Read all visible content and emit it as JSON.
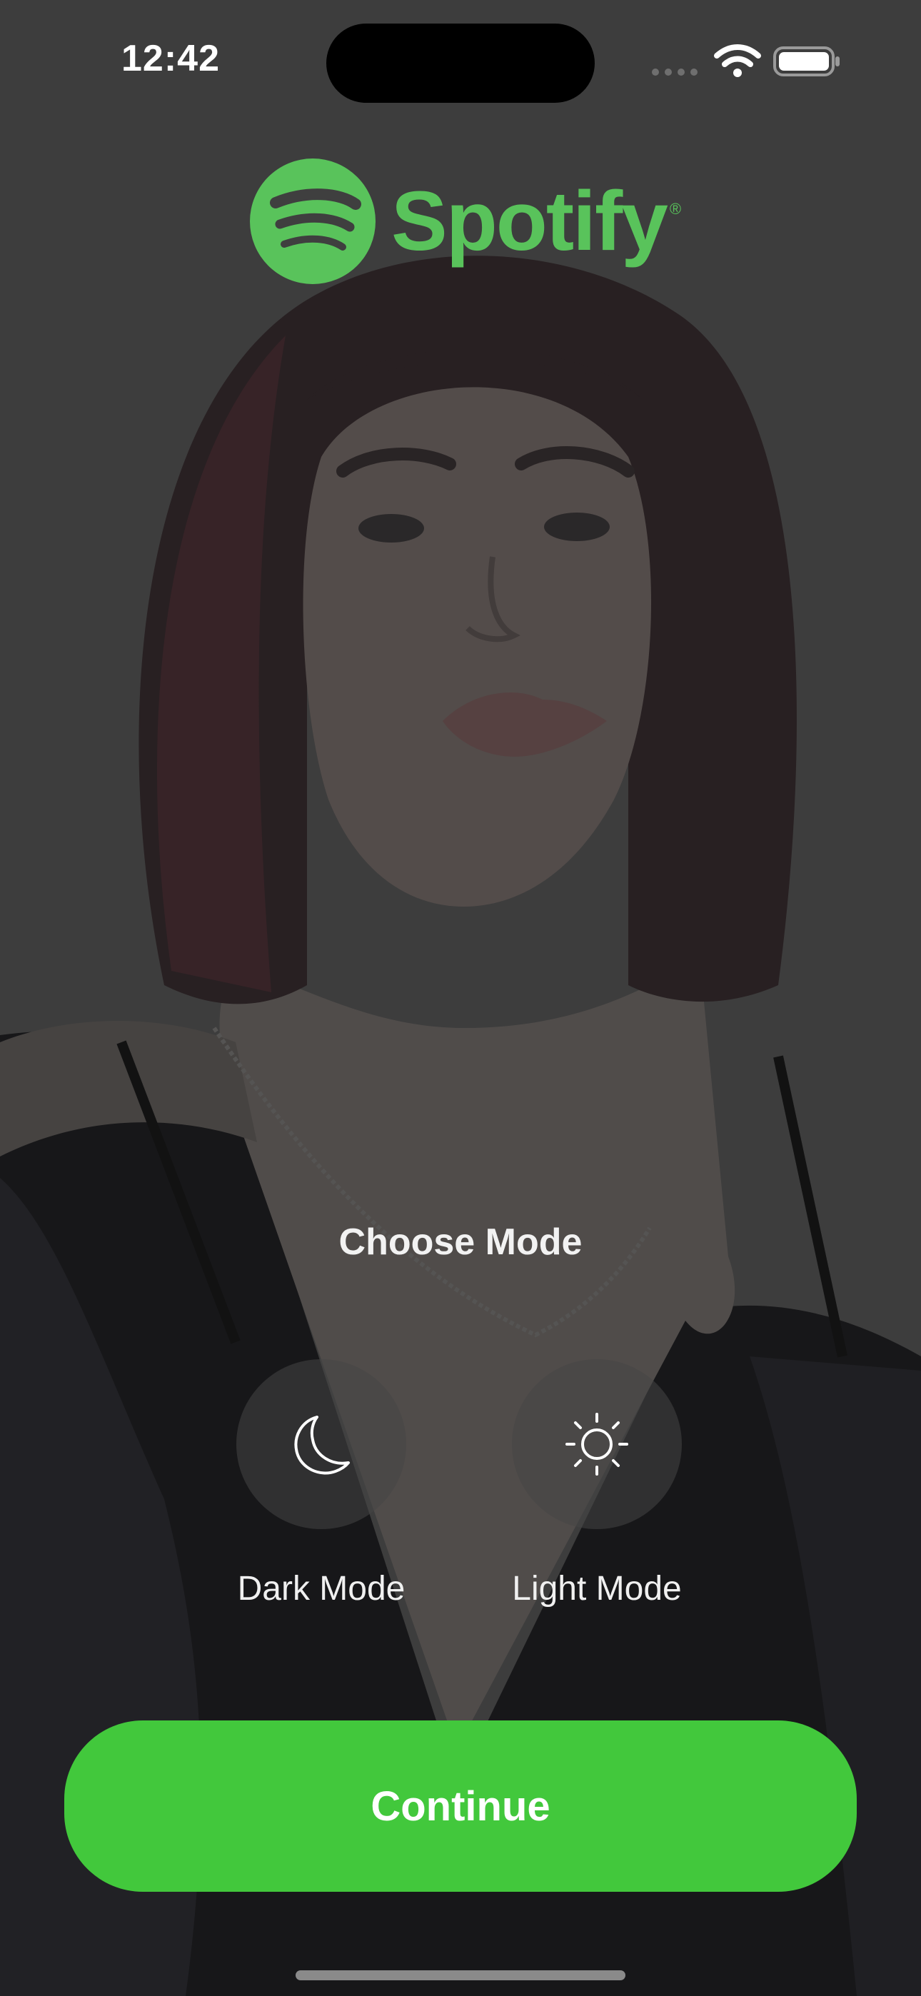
{
  "status_bar": {
    "time": "12:42"
  },
  "logo": {
    "wordmark": "Spotify",
    "registered": "®",
    "color": "#59c35b"
  },
  "mode_picker": {
    "title": "Choose Mode",
    "options": [
      {
        "label": "Dark Mode",
        "icon": "moon-icon"
      },
      {
        "label": "Light Mode",
        "icon": "sun-icon"
      }
    ]
  },
  "actions": {
    "continue_label": "Continue",
    "accent": "#42c83c"
  }
}
